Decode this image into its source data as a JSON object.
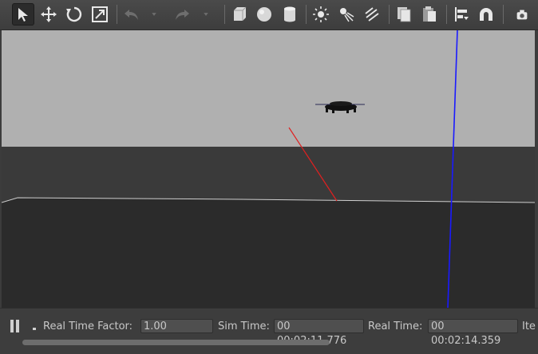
{
  "toolbar": {
    "tools": [
      {
        "name": "select-mode-icon",
        "active": true
      },
      {
        "name": "translate-mode-icon"
      },
      {
        "name": "rotate-mode-icon"
      },
      {
        "name": "scale-mode-icon"
      },
      {
        "name": "undo-icon"
      },
      {
        "name": "undo-dropdown-icon"
      },
      {
        "name": "redo-icon"
      },
      {
        "name": "redo-dropdown-icon"
      },
      {
        "name": "box-shape-icon"
      },
      {
        "name": "sphere-shape-icon"
      },
      {
        "name": "cylinder-shape-icon"
      },
      {
        "name": "point-light-icon"
      },
      {
        "name": "spot-light-icon"
      },
      {
        "name": "directional-light-icon"
      },
      {
        "name": "copy-icon"
      },
      {
        "name": "paste-icon"
      },
      {
        "name": "align-icon"
      },
      {
        "name": "snap-icon"
      },
      {
        "name": "screenshot-icon"
      }
    ]
  },
  "statusbar": {
    "step_label": "-",
    "real_time_factor_label": "Real Time Factor:",
    "real_time_factor_value": "1.00",
    "sim_time_label": "Sim Time:",
    "sim_time_value": "00 00:02:11.776",
    "real_time_label": "Real Time:",
    "real_time_value": "00 00:02:14.359",
    "iterations_label": "Ite"
  },
  "colors": {
    "sky": "#b0b0b0",
    "far_ground": "#3a3a3a",
    "ground": "#2b2b2b",
    "x_axis": "#e02020",
    "z_axis": "#1a1aff"
  }
}
